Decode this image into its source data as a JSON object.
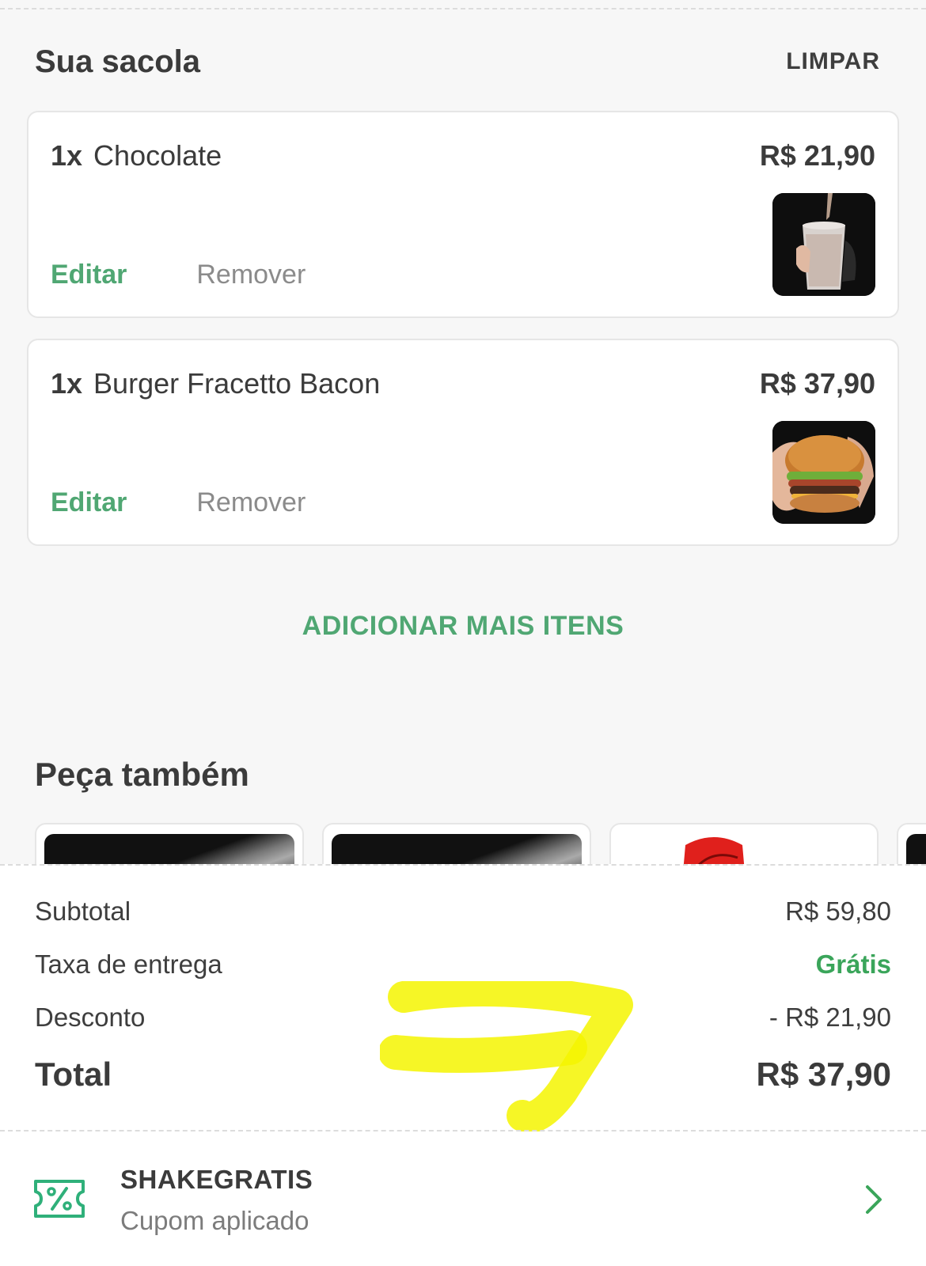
{
  "header": {
    "title": "Sua sacola",
    "clear_label": "LIMPAR"
  },
  "items": [
    {
      "qty": "1x",
      "name": "Chocolate",
      "price": "R$ 21,90",
      "edit_label": "Editar",
      "remove_label": "Remover",
      "image": "chocolate-shake"
    },
    {
      "qty": "1x",
      "name": "Burger Fracetto Bacon",
      "price": "R$ 37,90",
      "edit_label": "Editar",
      "remove_label": "Remover",
      "image": "bacon-burger"
    }
  ],
  "add_more_label": "ADICIONAR MAIS ITENS",
  "suggestions": {
    "title": "Peça também"
  },
  "summary": {
    "subtotal_label": "Subtotal",
    "subtotal_value": "R$ 59,80",
    "delivery_label": "Taxa de entrega",
    "delivery_value": "Grátis",
    "discount_label": "Desconto",
    "discount_value": "- R$ 21,90",
    "total_label": "Total",
    "total_value": "R$ 37,90"
  },
  "coupon": {
    "code": "SHAKEGRATIS",
    "status": "Cupom aplicado",
    "icon": "coupon-ticket-icon"
  },
  "colors": {
    "accent_green": "#50a773",
    "free_green": "#3aa55a",
    "highlight_yellow": "#f5f500"
  }
}
